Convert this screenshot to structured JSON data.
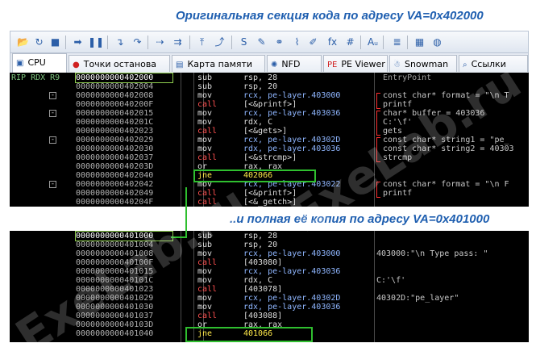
{
  "captions": {
    "top": "Оригинальная секция кода по адресу VA=0x402000",
    "middle": "..и полная её копия по адресу VA=0x401000"
  },
  "watermark": "ExeLab.ru",
  "toolbar": {
    "buttons": [
      {
        "icon": "open-folder-icon",
        "glyph": "📂"
      },
      {
        "icon": "restart-icon",
        "glyph": "↻"
      },
      {
        "icon": "stop-icon",
        "glyph": "■"
      },
      {
        "icon": "run-icon",
        "glyph": "➡"
      },
      {
        "icon": "pause-icon",
        "glyph": "❚❚"
      },
      {
        "icon": "step-into-icon",
        "glyph": "↴"
      },
      {
        "icon": "step-over-icon",
        "glyph": "↷"
      },
      {
        "icon": "run-to-icon",
        "glyph": "⇢"
      },
      {
        "icon": "trace-icon",
        "glyph": "⇉"
      },
      {
        "icon": "execute-till-return-icon",
        "glyph": "⤒"
      },
      {
        "icon": "run-to-user-code-icon",
        "glyph": "⤴"
      },
      {
        "icon": "script-icon",
        "glyph": "S"
      },
      {
        "icon": "patch-icon",
        "glyph": "✎"
      },
      {
        "icon": "link-icon",
        "glyph": "⚭"
      },
      {
        "icon": "paperclip-icon",
        "glyph": "⌇"
      },
      {
        "icon": "highlight-icon",
        "glyph": "✐"
      },
      {
        "icon": "function-icon",
        "glyph": "fx"
      },
      {
        "icon": "hash-icon",
        "glyph": "#"
      },
      {
        "icon": "font-icon",
        "glyph": "Aᵤ"
      },
      {
        "icon": "list-icon",
        "glyph": "≣"
      },
      {
        "icon": "calculator-icon",
        "glyph": "▦"
      },
      {
        "icon": "globe-icon",
        "glyph": "◍"
      }
    ]
  },
  "tabs": [
    {
      "label": "CPU",
      "icon": "cpu-icon",
      "glyph": "▣",
      "active": true
    },
    {
      "label": "Точки останова",
      "icon": "breakpoint-icon",
      "glyph": "●",
      "active": false
    },
    {
      "label": "Карта памяти",
      "icon": "memory-map-icon",
      "glyph": "▤",
      "active": false
    },
    {
      "label": "NFD",
      "icon": "nfd-icon",
      "glyph": "✺",
      "active": false
    },
    {
      "label": "PE Viewer",
      "icon": "pe-icon",
      "glyph": "PE",
      "active": false
    },
    {
      "label": "Snowman",
      "icon": "snowman-icon",
      "glyph": "☃",
      "active": false
    },
    {
      "label": "Ссылки",
      "icon": "search-icon",
      "glyph": "⌕",
      "active": false
    }
  ],
  "top_view": {
    "rows": [
      {
        "reg": "RIP RDX R9",
        "addr": "0000000000402000",
        "current": true,
        "mn": "sub",
        "op": "rsp, 28",
        "cm": "EntryPoint",
        "fold": ""
      },
      {
        "reg": "",
        "addr": "0000000000402004",
        "mn": "sub",
        "op": "rsp, 20",
        "cm": "",
        "fold": ""
      },
      {
        "reg": "",
        "addr": "0000000000402008",
        "mn": "mov",
        "op": "rcx, pe-layer.403000",
        "cm": "const char* format = \"\\n T",
        "fold": "−"
      },
      {
        "reg": "",
        "addr": "000000000040200F",
        "mn": "call",
        "op": "[<&printf>]",
        "cm": "printf",
        "fold": ""
      },
      {
        "reg": "",
        "addr": "0000000000402015",
        "mn": "mov",
        "op": "rcx, pe-layer.403036",
        "cm": "char* buffer = 403036",
        "fold": "−"
      },
      {
        "reg": "",
        "addr": "000000000040201C",
        "mn": "mov",
        "op": "rdx, C",
        "cm": "C:'\\f'",
        "fold": ""
      },
      {
        "reg": "",
        "addr": "0000000000402023",
        "mn": "call",
        "op": "[<&gets>]",
        "cm": "gets",
        "fold": ""
      },
      {
        "reg": "",
        "addr": "0000000000402029",
        "mn": "mov",
        "op": "rcx, pe-layer.40302D",
        "cm": "const char* string1 = \"pe_",
        "fold": "−"
      },
      {
        "reg": "",
        "addr": "0000000000402030",
        "mn": "mov",
        "op": "rdx, pe-layer.403036",
        "cm": "const char* string2 = 40303",
        "fold": ""
      },
      {
        "reg": "",
        "addr": "0000000000402037",
        "mn": "call",
        "op": "[<&strcmp>]",
        "cm": "strcmp",
        "fold": ""
      },
      {
        "reg": "",
        "addr": "000000000040203D",
        "mn": "or",
        "op": "rax, rax",
        "cm": "",
        "fold": ""
      },
      {
        "reg": "",
        "addr": "0000000000402040",
        "mn": "jne",
        "op": "402066",
        "cm": "",
        "fold": ""
      },
      {
        "reg": "",
        "addr": "0000000000402042",
        "mn": "mov",
        "op": "rcx, pe-layer.403022",
        "cm": "const char* format = \"\\n F",
        "fold": "−"
      },
      {
        "reg": "",
        "addr": "0000000000402049",
        "mn": "call",
        "op": "[<&printf>]",
        "cm": "printf",
        "fold": ""
      },
      {
        "reg": "",
        "addr": "000000000040204F",
        "mn": "call",
        "op": "[<&_getch>]",
        "cm": "",
        "fold": ""
      }
    ]
  },
  "bottom_view": {
    "rows": [
      {
        "reg": "",
        "addr": "0000000000401000",
        "current": true,
        "mn": "sub",
        "op": "rsp, 28",
        "cm": ""
      },
      {
        "reg": "",
        "addr": "0000000000401004",
        "mn": "sub",
        "op": "rsp, 20",
        "cm": ""
      },
      {
        "reg": "",
        "addr": "0000000000401008",
        "mn": "mov",
        "op": "rcx, pe-layer.403000",
        "cm": "403000:\"\\n Type pass: \""
      },
      {
        "reg": "",
        "addr": "000000000040100F",
        "mn": "call",
        "op": "[403080]",
        "cm": ""
      },
      {
        "reg": "",
        "addr": "0000000000401015",
        "mn": "mov",
        "op": "rcx, pe-layer.403036",
        "cm": ""
      },
      {
        "reg": "",
        "addr": "000000000040101C",
        "mn": "mov",
        "op": "rdx, C",
        "cm": "C:'\\f'"
      },
      {
        "reg": "",
        "addr": "0000000000401023",
        "mn": "call",
        "op": "[403078]",
        "cm": ""
      },
      {
        "reg": "",
        "addr": "0000000000401029",
        "mn": "mov",
        "op": "rcx, pe-layer.40302D",
        "cm": "40302D:\"pe_layer\""
      },
      {
        "reg": "",
        "addr": "0000000000401030",
        "mn": "mov",
        "op": "rdx, pe-layer.403036",
        "cm": ""
      },
      {
        "reg": "",
        "addr": "0000000000401037",
        "mn": "call",
        "op": "[403088]",
        "cm": ""
      },
      {
        "reg": "",
        "addr": "000000000040103D",
        "mn": "or",
        "op": "rax, rax",
        "cm": ""
      },
      {
        "reg": "",
        "addr": "0000000000401040",
        "mn": "jne",
        "op": "401066",
        "cm": ""
      }
    ]
  },
  "colors": {
    "highlight_box": "#2fbf2f",
    "call": "#ff5050",
    "jump": "#ffe94a",
    "caption": "#1f5fb0"
  }
}
